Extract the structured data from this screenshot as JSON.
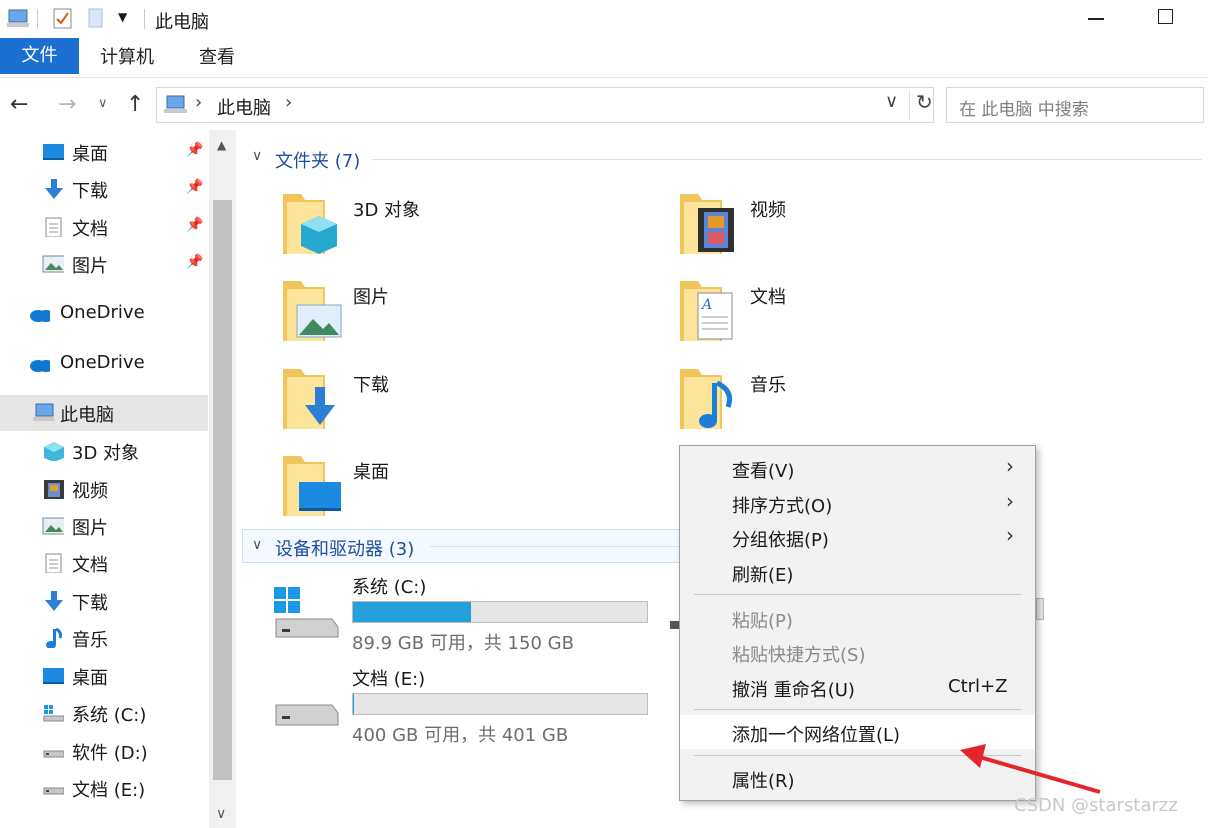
{
  "window": {
    "title": "此电脑"
  },
  "ribbon": {
    "tabs": [
      "文件",
      "计算机",
      "查看"
    ]
  },
  "address": {
    "location": "此电脑"
  },
  "search": {
    "placeholder": "在 此电脑 中搜索"
  },
  "nav": {
    "quick_access": [
      {
        "label": "桌面",
        "icon": "desktop-icon",
        "pinned": true
      },
      {
        "label": "下载",
        "icon": "download-icon",
        "pinned": true
      },
      {
        "label": "文档",
        "icon": "document-icon",
        "pinned": true
      },
      {
        "label": "图片",
        "icon": "picture-icon",
        "pinned": true
      }
    ],
    "onedrive": [
      "OneDrive",
      "OneDrive"
    ],
    "this_pc": "此电脑",
    "this_pc_items": [
      {
        "label": "3D 对象",
        "icon": "3d-objects-icon"
      },
      {
        "label": "视频",
        "icon": "video-icon"
      },
      {
        "label": "图片",
        "icon": "picture-icon"
      },
      {
        "label": "文档",
        "icon": "document-icon"
      },
      {
        "label": "下载",
        "icon": "download-icon"
      },
      {
        "label": "音乐",
        "icon": "music-icon"
      },
      {
        "label": "桌面",
        "icon": "desktop-icon"
      },
      {
        "label": "系统 (C:)",
        "icon": "windows-drive-icon"
      },
      {
        "label": "软件 (D:)",
        "icon": "drive-icon"
      },
      {
        "label": "文档 (E:)",
        "icon": "drive-icon"
      }
    ]
  },
  "content": {
    "folders_header": "文件夹 (7)",
    "folders": [
      {
        "name": "3D 对象",
        "icon": "3d-objects-folder-icon"
      },
      {
        "name": "视频",
        "icon": "video-folder-icon"
      },
      {
        "name": "图片",
        "icon": "picture-folder-icon"
      },
      {
        "name": "文档",
        "icon": "document-folder-icon"
      },
      {
        "name": "下载",
        "icon": "download-folder-icon"
      },
      {
        "name": "音乐",
        "icon": "music-folder-icon"
      },
      {
        "name": "桌面",
        "icon": "desktop-folder-icon"
      }
    ],
    "drives_header": "设备和驱动器 (3)",
    "drives": [
      {
        "name": "系统 (C:)",
        "info": "89.9 GB 可用，共 150 GB",
        "used_fraction": 0.4
      },
      {
        "name": "文档 (E:)",
        "info": "400 GB 可用，共 401 GB",
        "used_fraction": 0.0025
      }
    ]
  },
  "context_menu": {
    "items": [
      {
        "label": "查看(V)",
        "submenu": true
      },
      {
        "label": "排序方式(O)",
        "submenu": true
      },
      {
        "label": "分组依据(P)",
        "submenu": true
      },
      {
        "label": "刷新(E)"
      },
      {
        "label": "粘贴(P)",
        "disabled": true
      },
      {
        "label": "粘贴快捷方式(S)",
        "disabled": true
      },
      {
        "label": "撤消 重命名(U)",
        "shortcut": "Ctrl+Z"
      },
      {
        "label": "添加一个网络位置(L)",
        "highlighted": true
      },
      {
        "label": "属性(R)"
      }
    ]
  },
  "watermark": "CSDN @starstarzz",
  "colors": {
    "accent": "#1a6fd0",
    "annotation_arrow": "#e3262b",
    "drive_bar": "#26a0da"
  }
}
